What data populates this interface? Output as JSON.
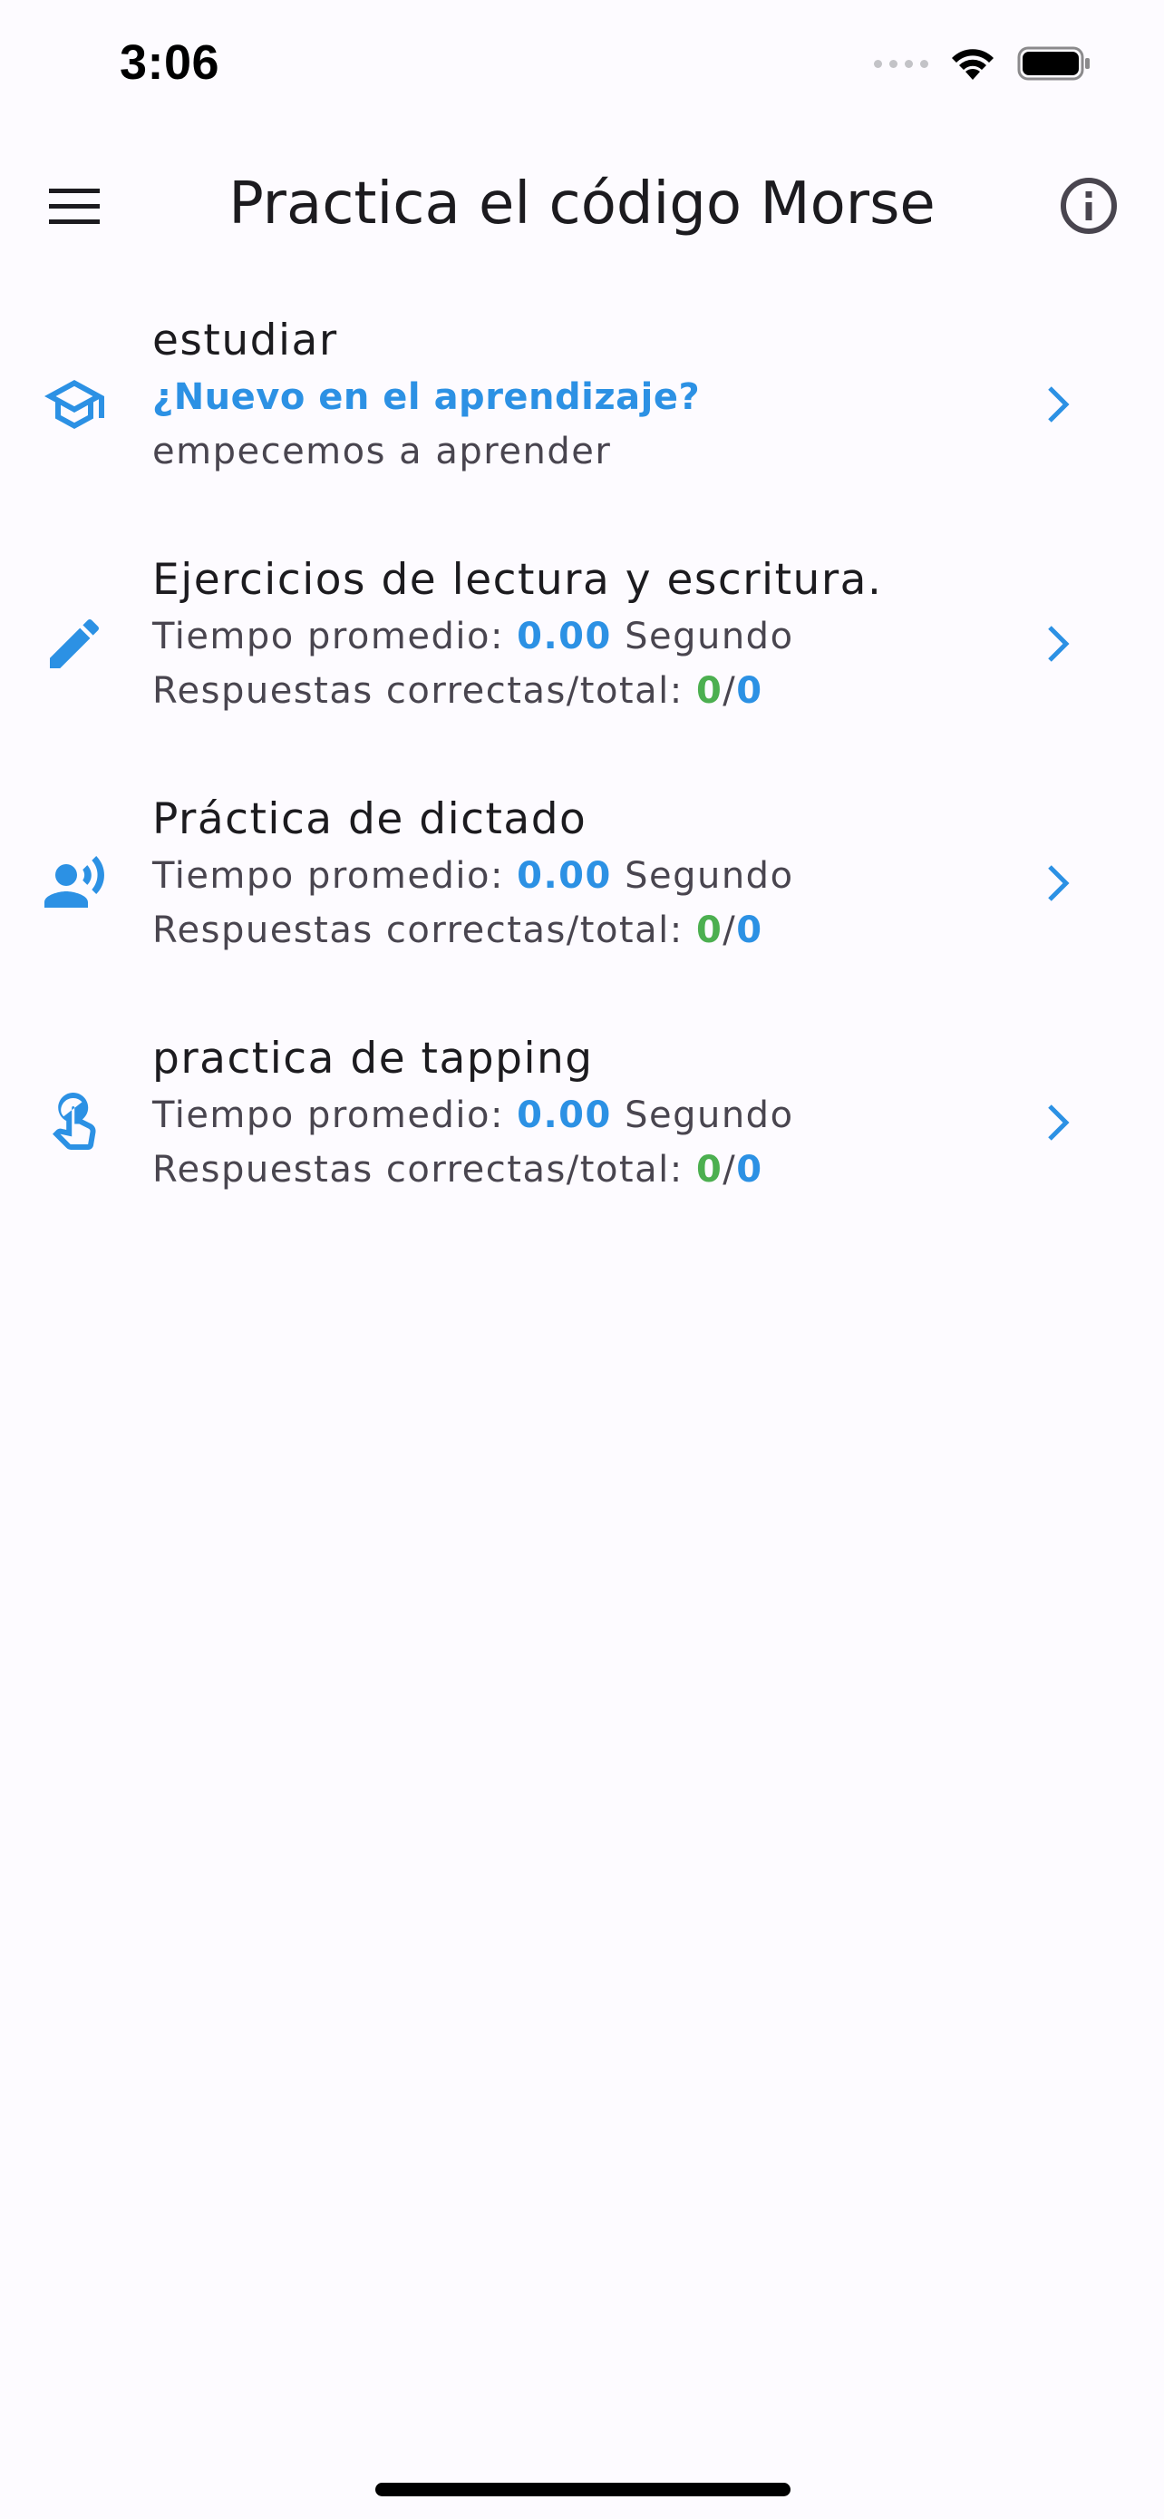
{
  "status_bar": {
    "time": "3:06"
  },
  "app_bar": {
    "title": "Practica el código Morse",
    "menu_icon": "menu-icon",
    "info_icon": "info-icon"
  },
  "colors": {
    "accent": "#2c91e4",
    "success": "#4caf50",
    "background": "#fdfbff",
    "text_primary": "#1c1b1f",
    "text_secondary": "#49454f"
  },
  "items": [
    {
      "icon": "graduation-cap-icon",
      "title": "estudiar",
      "subtitle": "¿Nuevo en el aprendizaje?",
      "detail": "empecemos a aprender"
    },
    {
      "icon": "pencil-icon",
      "title": "Ejercicios de lectura y escritura.",
      "time_label": "Tiempo promedio:",
      "time_value": "0.00",
      "time_unit": "Segundo",
      "answers_label": "Respuestas correctas/total:",
      "correct": "0",
      "separator": "/",
      "total": "0"
    },
    {
      "icon": "record-voice-icon",
      "title": "Práctica de dictado",
      "time_label": "Tiempo promedio:",
      "time_value": "0.00",
      "time_unit": "Segundo",
      "answers_label": "Respuestas correctas/total:",
      "correct": "0",
      "separator": "/",
      "total": "0"
    },
    {
      "icon": "touch-icon",
      "title": "practica de tapping",
      "time_label": "Tiempo promedio:",
      "time_value": "0.00",
      "time_unit": "Segundo",
      "answers_label": "Respuestas correctas/total:",
      "correct": "0",
      "separator": "/",
      "total": "0"
    }
  ]
}
